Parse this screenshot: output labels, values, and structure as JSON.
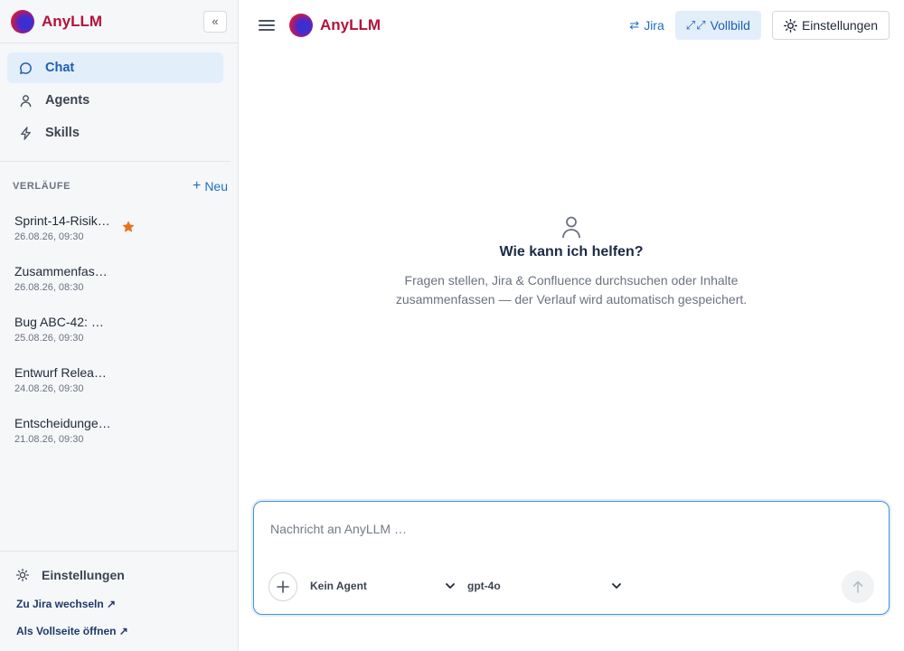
{
  "brand": {
    "name": "AnyLLM"
  },
  "sidebar": {
    "collapse_label": "«",
    "nav": [
      {
        "label": "Chat",
        "icon": "chat-bubble-icon",
        "active": true
      },
      {
        "label": "Agents",
        "icon": "user-icon",
        "active": false
      },
      {
        "label": "Skills",
        "icon": "lightning-icon",
        "active": false
      }
    ],
    "history": {
      "title": "VERLÄUFE",
      "new_label": "Neu",
      "items": [
        {
          "title": "Sprint-14-Risik…",
          "date": "26.08.26, 09:30",
          "starred": true
        },
        {
          "title": "Zusammenfas…",
          "date": "26.08.26, 08:30",
          "starred": false
        },
        {
          "title": "Bug ABC-42: …",
          "date": "25.08.26, 09:30",
          "starred": false
        },
        {
          "title": "Entwurf Relea…",
          "date": "24.08.26, 09:30",
          "starred": false
        },
        {
          "title": "Entscheidunge…",
          "date": "21.08.26, 09:30",
          "starred": false
        }
      ]
    },
    "footer": {
      "settings_label": "Einstellungen",
      "jira_link": "Zu Jira wechseln ↗",
      "fullpage_link": "Als Vollseite öffnen ↗"
    }
  },
  "topbar": {
    "jira_label": "Jira",
    "fullscreen_label": "Vollbild",
    "settings_label": "Einstellungen"
  },
  "empty_state": {
    "title": "Wie kann ich helfen?",
    "description_line1": "Fragen stellen, Jira & Confluence durchsuchen oder Inhalte",
    "description_line2": "zusammenfassen — der Verlauf wird automatisch gespeichert."
  },
  "composer": {
    "placeholder": "Nachricht an AnyLLM …",
    "value": "",
    "agent_select": "Kein Agent",
    "model_select": "gpt-4o"
  },
  "colors": {
    "brand_red": "#b4123a",
    "accent_blue": "#1d6fc1",
    "active_bg": "#e3eefb",
    "star_orange": "#e8711c"
  }
}
